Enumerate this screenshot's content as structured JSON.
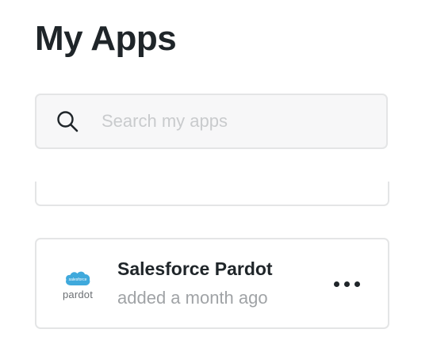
{
  "header": {
    "title": "My Apps"
  },
  "search": {
    "placeholder": "Search my apps",
    "value": "",
    "icon": "search-icon"
  },
  "apps": [
    {
      "name": "Salesforce Pardot",
      "subtitle": "added a month ago",
      "logo_brand_text": "salesforce",
      "logo_text": "pardot",
      "logo_color": "#3fa9dc",
      "menu_icon": "more-icon"
    }
  ],
  "colors": {
    "title": "#1f2529",
    "border": "#e4e5e6",
    "muted_text": "#a0a3a6",
    "search_bg": "#f7f7f8"
  }
}
